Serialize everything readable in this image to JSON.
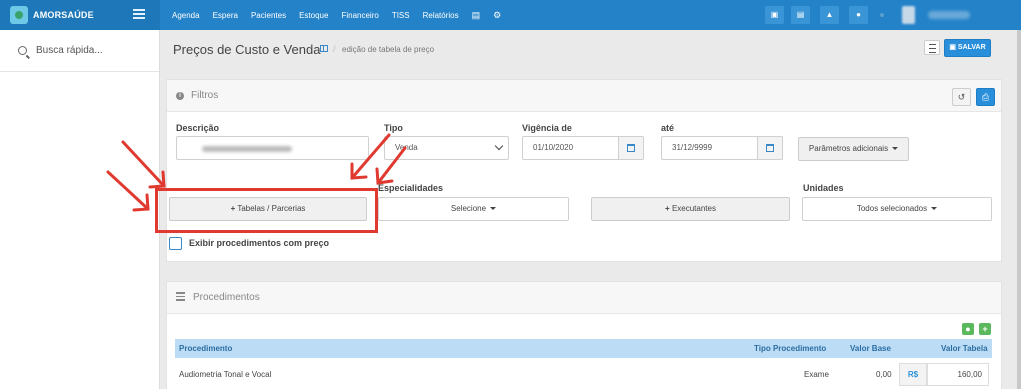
{
  "topbar": {
    "brand": "AMORSAÚDE",
    "nav": [
      "Agenda",
      "Espera",
      "Pacientes",
      "Estoque",
      "Financeiro",
      "TISS",
      "Relatórios"
    ],
    "nav_icons": [
      "database-icon",
      "gear-icon"
    ],
    "action_icons": [
      "inbox-icon",
      "message-icon",
      "bell-icon",
      "chat-icon"
    ]
  },
  "sidebar": {
    "search_label": "Busca rápida..."
  },
  "header": {
    "title": "Preços de Custo e Venda",
    "sep": "/",
    "crumb": "edição de tabela de preço",
    "save_label": "SALVAR"
  },
  "filters": {
    "title": "Filtros",
    "descricao_label": "Descrição",
    "tipo_label": "Tipo",
    "tipo_value": "Venda",
    "vigencia_label": "Vigência de",
    "vigencia_value": "01/10/2020",
    "ate_label": "até",
    "ate_value": "31/12/9999",
    "parametros_label": "Parâmetros adicionais",
    "tabelas_label": "Tabelas / Parcerias",
    "especialidades_label": "Especialidades",
    "especialidades_value": "Selecione",
    "executantes_label": "Executantes",
    "unidades_label": "Unidades",
    "unidades_value": "Todos selecionados",
    "checkbox_label": "Exibir procedimentos com preço",
    "checkbox_checked": false
  },
  "procedures": {
    "title": "Procedimentos",
    "columns": [
      "Procedimento",
      "Tipo Procedimento",
      "Valor Base",
      "Valor Tabela"
    ],
    "rows": [
      {
        "procedimento": "Audiometria Tonal e Vocal",
        "tipo": "Exame",
        "valor_base": "0,00",
        "currency": "R$",
        "valor_tabela": "160,00"
      }
    ]
  },
  "colors": {
    "primary": "#2382c8",
    "annotation": "#e03a30",
    "success": "#5cb85c"
  }
}
